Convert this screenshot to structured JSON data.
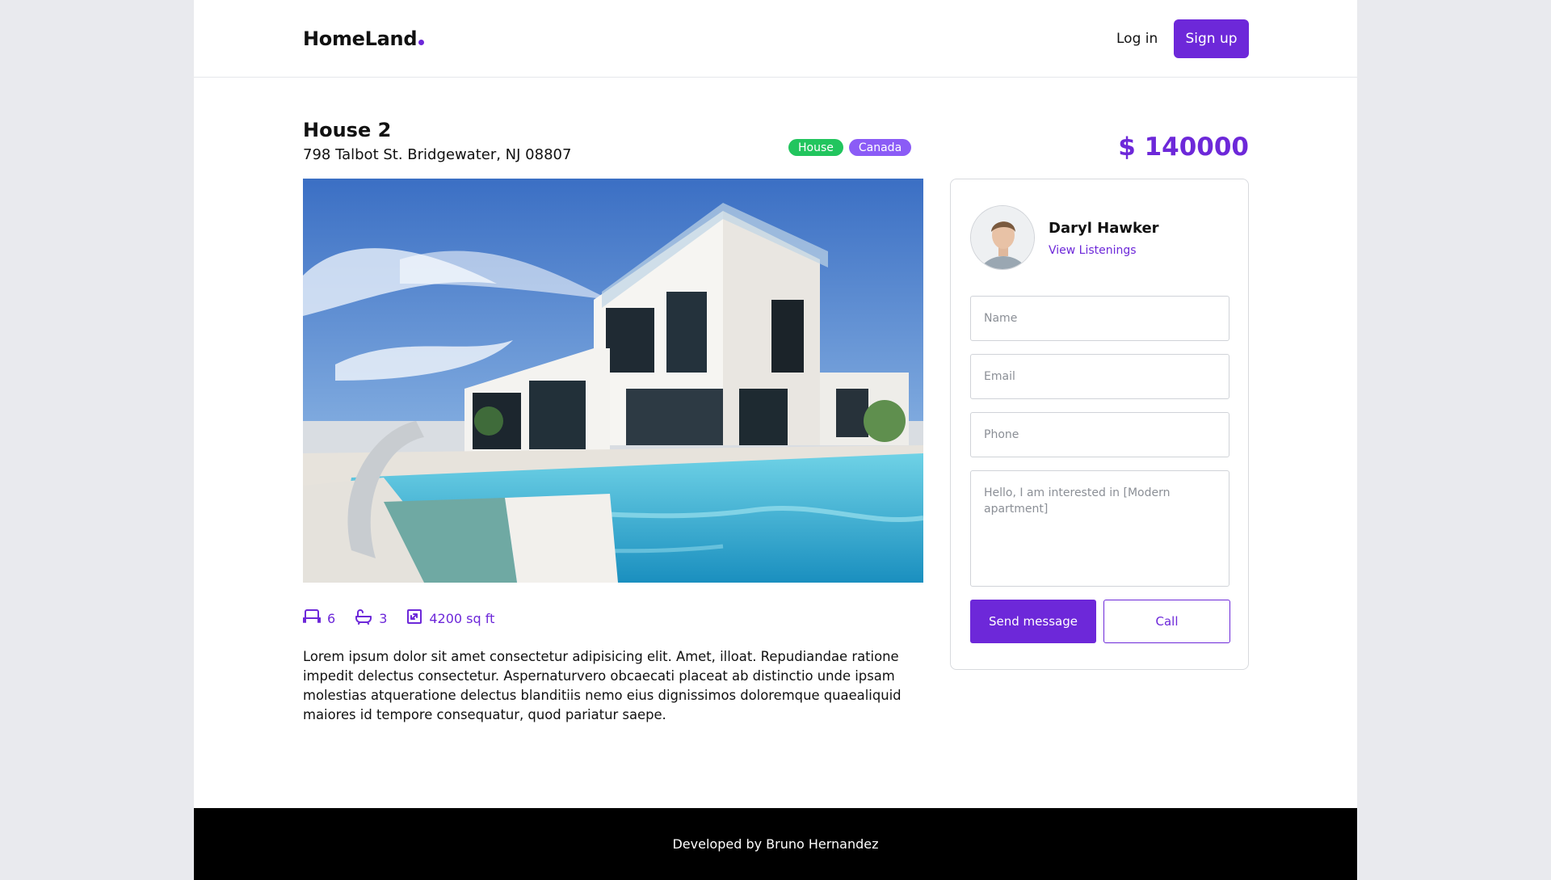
{
  "colors": {
    "accent": "#6d28d9",
    "tag_house": "#22c55e",
    "tag_location": "#8b5cf6",
    "footer_bg": "#000000"
  },
  "header": {
    "logo_text": "HomeLand",
    "login_label": "Log in",
    "signup_label": "Sign up"
  },
  "listing": {
    "title": "House 2",
    "address": "798 Talbot St. Bridgewater, NJ 08807",
    "tags": [
      "House",
      "Canada"
    ],
    "price": "$ 140000",
    "photo_alt": "Modern white house with swimming pool",
    "features": {
      "beds": "6",
      "baths": "3",
      "area": "4200 sq ft"
    },
    "description": "Lorem ipsum dolor sit amet consectetur adipisicing elit. Amet, illoat. Repudiandae ratione impedit delectus consectetur. Aspernaturvero obcaecati placeat ab distinctio unde ipsam molestias atqueratione delectus blanditiis nemo eius dignissimos doloremque quaealiquid maiores id tempore consequatur, quod pariatur saepe."
  },
  "agent": {
    "name": "Daryl Hawker",
    "link_label": "View Listenings"
  },
  "form": {
    "name_placeholder": "Name",
    "email_placeholder": "Email",
    "phone_placeholder": "Phone",
    "message_placeholder": "Hello, I am interested in [Modern apartment]",
    "send_label": "Send message",
    "call_label": "Call"
  },
  "footer": {
    "text": "Developed by Bruno Hernandez"
  }
}
